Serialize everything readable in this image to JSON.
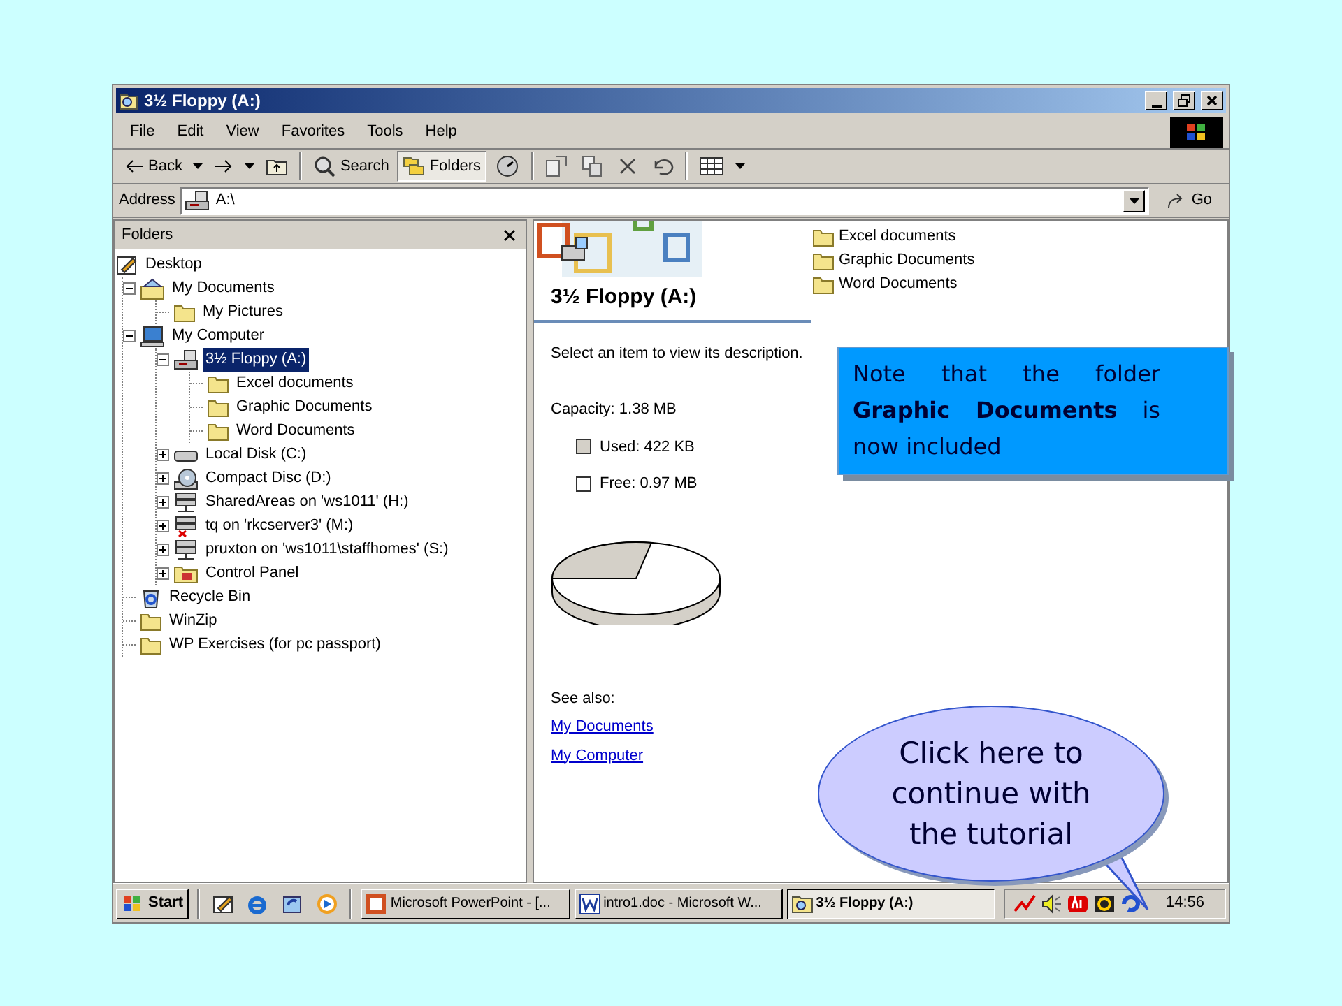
{
  "window": {
    "title": "3½ Floppy (A:)"
  },
  "menu": [
    "File",
    "Edit",
    "View",
    "Favorites",
    "Tools",
    "Help"
  ],
  "toolbar": [
    {
      "kind": "back",
      "label": "Back",
      "dropdown": true,
      "pressed": false
    },
    {
      "kind": "forward",
      "dropdown": true,
      "pressed": false
    },
    {
      "kind": "up",
      "pressed": false
    },
    {
      "kind": "separator"
    },
    {
      "kind": "search",
      "label": "Search",
      "pressed": false
    },
    {
      "kind": "folders",
      "label": "Folders",
      "pressed": true
    },
    {
      "kind": "history",
      "pressed": false
    },
    {
      "kind": "separator"
    },
    {
      "kind": "move",
      "pressed": false
    },
    {
      "kind": "copy",
      "pressed": false
    },
    {
      "kind": "delete",
      "pressed": false
    },
    {
      "kind": "undo",
      "pressed": false
    },
    {
      "kind": "separator"
    },
    {
      "kind": "views",
      "dropdown": true,
      "pressed": false
    }
  ],
  "address": {
    "label": "Address",
    "value": "A:\\",
    "go": "Go"
  },
  "folders_pane": {
    "title": "Folders",
    "tree": [
      {
        "kind": "desktop",
        "label": "Desktop",
        "selected": false,
        "children": [
          {
            "kind": "documents",
            "label": "My Documents",
            "expanded": true,
            "selected": false,
            "children": [
              {
                "kind": "folder",
                "label": "My Pictures",
                "selected": false
              }
            ]
          },
          {
            "kind": "computer",
            "label": "My Computer",
            "expanded": true,
            "selected": false,
            "children": [
              {
                "kind": "floppy",
                "label": "3½ Floppy (A:)",
                "expanded": true,
                "selected": true,
                "children": [
                  {
                    "kind": "folder",
                    "label": "Excel documents",
                    "selected": false
                  },
                  {
                    "kind": "folder",
                    "label": "Graphic Documents",
                    "selected": false
                  },
                  {
                    "kind": "folder",
                    "label": "Word Documents",
                    "selected": false
                  }
                ]
              },
              {
                "kind": "disk",
                "label": "Local Disk (C:)",
                "expanded": false,
                "selected": false
              },
              {
                "kind": "cd",
                "label": "Compact Disc (D:)",
                "expanded": false,
                "selected": false
              },
              {
                "kind": "network",
                "label": "SharedAreas on 'ws1011' (H:)",
                "expanded": false,
                "selected": false
              },
              {
                "kind": "network-offline",
                "label": "tq on 'rkcserver3' (M:)",
                "expanded": false,
                "selected": false
              },
              {
                "kind": "network",
                "label": "pruxton on 'ws1011\\staffhomes' (S:)",
                "expanded": false,
                "selected": false
              },
              {
                "kind": "control-panel",
                "label": "Control Panel",
                "expanded": false,
                "selected": false
              }
            ]
          },
          {
            "kind": "recycle",
            "label": "Recycle Bin",
            "selected": false
          },
          {
            "kind": "folder",
            "label": "WinZip",
            "selected": false
          },
          {
            "kind": "folder",
            "label": "WP Exercises (for pc passport)",
            "selected": false
          }
        ]
      }
    ]
  },
  "details": {
    "title": "3½ Floppy (A:)",
    "description": "Select an item to view its description.",
    "capacity": "Capacity: 1.38 MB",
    "legend": [
      {
        "label": "Used: 422 KB",
        "color": "#d4d0c8"
      },
      {
        "label": "Free: 0.97 MB",
        "color": "#ffffff"
      }
    ],
    "see_also": "See also:",
    "links": [
      "My Documents",
      "My Computer"
    ]
  },
  "files": [
    "Excel documents",
    "Graphic Documents",
    "Word Documents"
  ],
  "note": "Note that the folder **Graphic Documents** is now included",
  "callout": "Click here to continue with the tutorial",
  "taskbar": {
    "start": "Start",
    "tasks": [
      {
        "kind": "presentation",
        "label": "Microsoft PowerPoint - [...",
        "selected": false
      },
      {
        "kind": "document",
        "label": "intro1.doc - Microsoft W...",
        "selected": false
      },
      {
        "kind": "explorer",
        "label": "3½ Floppy (A:)",
        "selected": true
      }
    ],
    "clock": "14:56"
  }
}
